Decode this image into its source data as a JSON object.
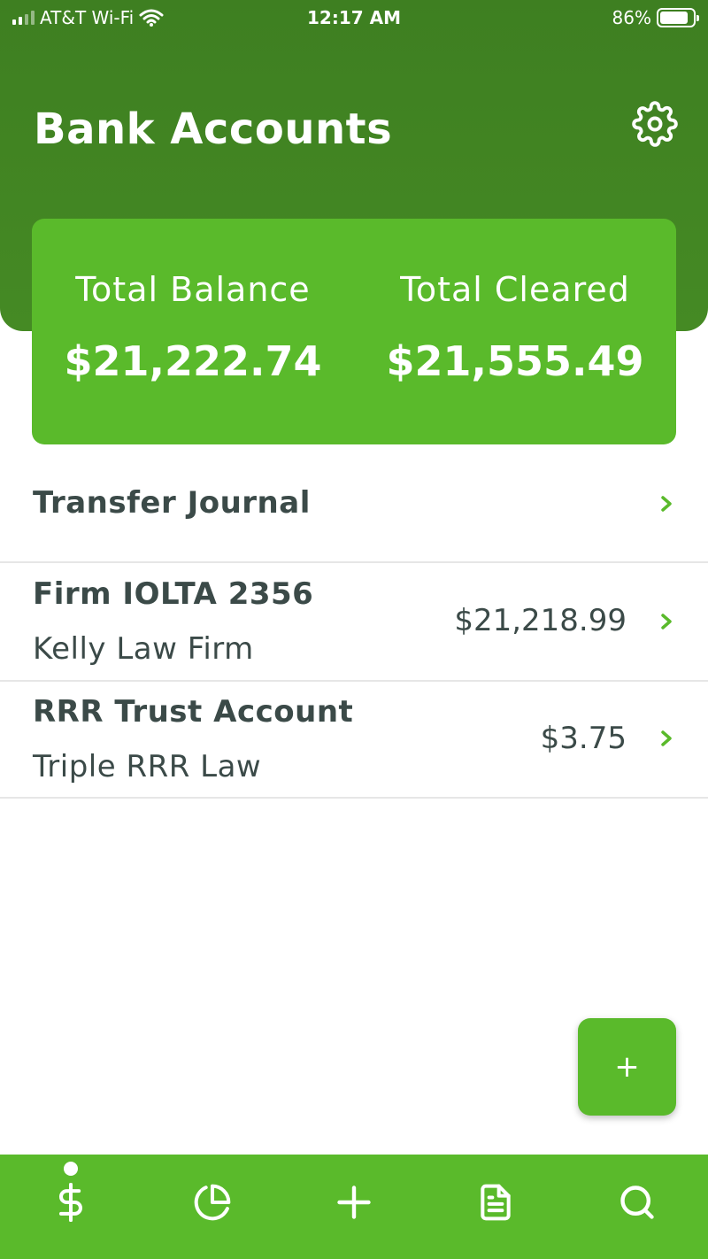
{
  "status_bar": {
    "carrier": "AT&T Wi-Fi",
    "time": "12:17 AM",
    "battery": "86%"
  },
  "header": {
    "title": "Bank Accounts",
    "settings_icon": "gear-icon"
  },
  "summary": {
    "total_balance_label": "Total Balance",
    "total_balance_value": "$21,222.74",
    "total_cleared_label": "Total Cleared",
    "total_cleared_value": "$21,555.49"
  },
  "transfer_journal": {
    "label": "Transfer Journal"
  },
  "accounts": [
    {
      "name": "Firm IOLTA 2356",
      "firm": "Kelly Law Firm",
      "balance": "$21,218.99"
    },
    {
      "name": "RRR Trust Account",
      "firm": "Triple RRR Law",
      "balance": "$3.75"
    }
  ],
  "fab": {
    "label": "+"
  },
  "tabbar": {
    "items": [
      {
        "icon": "dollar-icon",
        "active": true
      },
      {
        "icon": "pie-chart-icon",
        "active": false
      },
      {
        "icon": "plus-icon",
        "active": false
      },
      {
        "icon": "document-icon",
        "active": false
      },
      {
        "icon": "search-icon",
        "active": false
      }
    ]
  },
  "colors": {
    "header": "#3e7f21",
    "accent": "#5aba2b",
    "text": "#3b4a48"
  }
}
